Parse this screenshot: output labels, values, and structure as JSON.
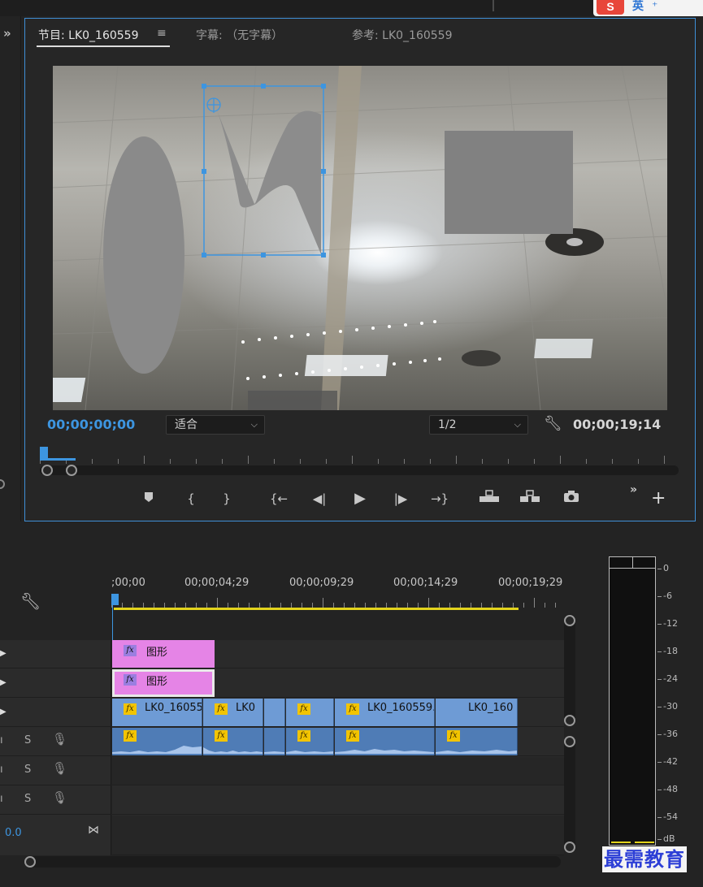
{
  "ime": {
    "logo": "S",
    "lang": "英",
    "arrow": "⁺"
  },
  "program_monitor": {
    "tabs": [
      {
        "label": "节目: LK0_160559",
        "menu": "≡"
      },
      {
        "label": "字幕: （无字幕）"
      },
      {
        "label": "参考: LK0_160559"
      }
    ],
    "current_timecode": "00;00;00;00",
    "zoom": "适合",
    "resolution": "1/2",
    "duration_timecode": "00;00;19;14",
    "more": "»",
    "add": "+"
  },
  "timeline": {
    "ruler_labels": [
      ";00;00",
      "00;00;04;29",
      "00;00;09;29",
      "00;00;14;29",
      "00;00;19;29"
    ],
    "graphics_clips": [
      {
        "fx": "fx",
        "label": "图形"
      },
      {
        "fx": "fx",
        "label": "图形"
      }
    ],
    "video_clips": [
      {
        "fx": "fx",
        "label": "LK0_16055"
      },
      {
        "fx": "fx",
        "label": "LK0"
      },
      {
        "fx": "",
        "label": ""
      },
      {
        "fx": "fx",
        "label": ""
      },
      {
        "fx": "fx",
        "label": "LK0_160559."
      },
      {
        "fx": "",
        "label": "LK0_160"
      }
    ],
    "audio_clips": [
      {
        "fx": "fx"
      },
      {
        "fx": "fx"
      },
      {
        "fx": ""
      },
      {
        "fx": "fx"
      },
      {
        "fx": "fx"
      },
      {
        "fx": "fx"
      }
    ],
    "audio_tracks": [
      {
        "solo": "S"
      },
      {
        "solo": "S"
      },
      {
        "solo": "S"
      }
    ],
    "master_level": "0.0"
  },
  "audio_meter": {
    "scale": [
      "0",
      "-6",
      "-12",
      "-18",
      "-24",
      "-30",
      "-36",
      "-42",
      "-48",
      "-54",
      "dB"
    ]
  },
  "watermark": "最需教育",
  "colors": {
    "accent": "#3d95e0",
    "graphic_clip": "#e584e6",
    "video_clip": "#6e9bd5",
    "audio_clip": "#4f7cb6",
    "work_area": "#e2d31c"
  }
}
